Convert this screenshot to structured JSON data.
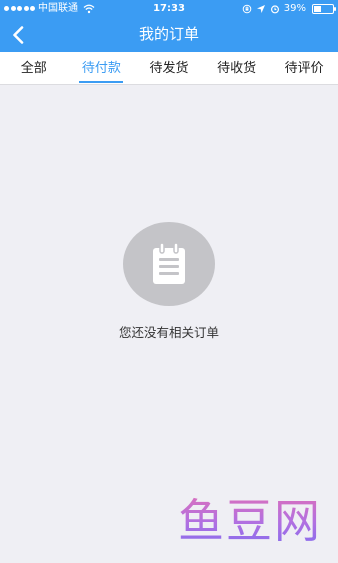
{
  "status_bar": {
    "carrier": "中国联通",
    "time": "17:33",
    "battery_percent": "39%",
    "battery_level": 0.39,
    "icons": [
      "signal-dots-icon",
      "wifi-icon",
      "rotation-lock-icon",
      "location-arrow-icon",
      "alarm-icon",
      "battery-icon"
    ]
  },
  "header": {
    "title": "我的订单",
    "back_icon": "chevron-left-icon"
  },
  "tabs": [
    {
      "label": "全部",
      "active": false
    },
    {
      "label": "待付款",
      "active": true
    },
    {
      "label": "待发货",
      "active": false
    },
    {
      "label": "待收货",
      "active": false
    },
    {
      "label": "待评价",
      "active": false
    }
  ],
  "empty_state": {
    "icon": "clipboard-icon",
    "message": "您还没有相关订单"
  },
  "watermark": {
    "text": "鱼豆网"
  },
  "colors": {
    "accent": "#3b9cf3",
    "background": "#efeff4",
    "empty_circle": "#c4c4c8"
  }
}
